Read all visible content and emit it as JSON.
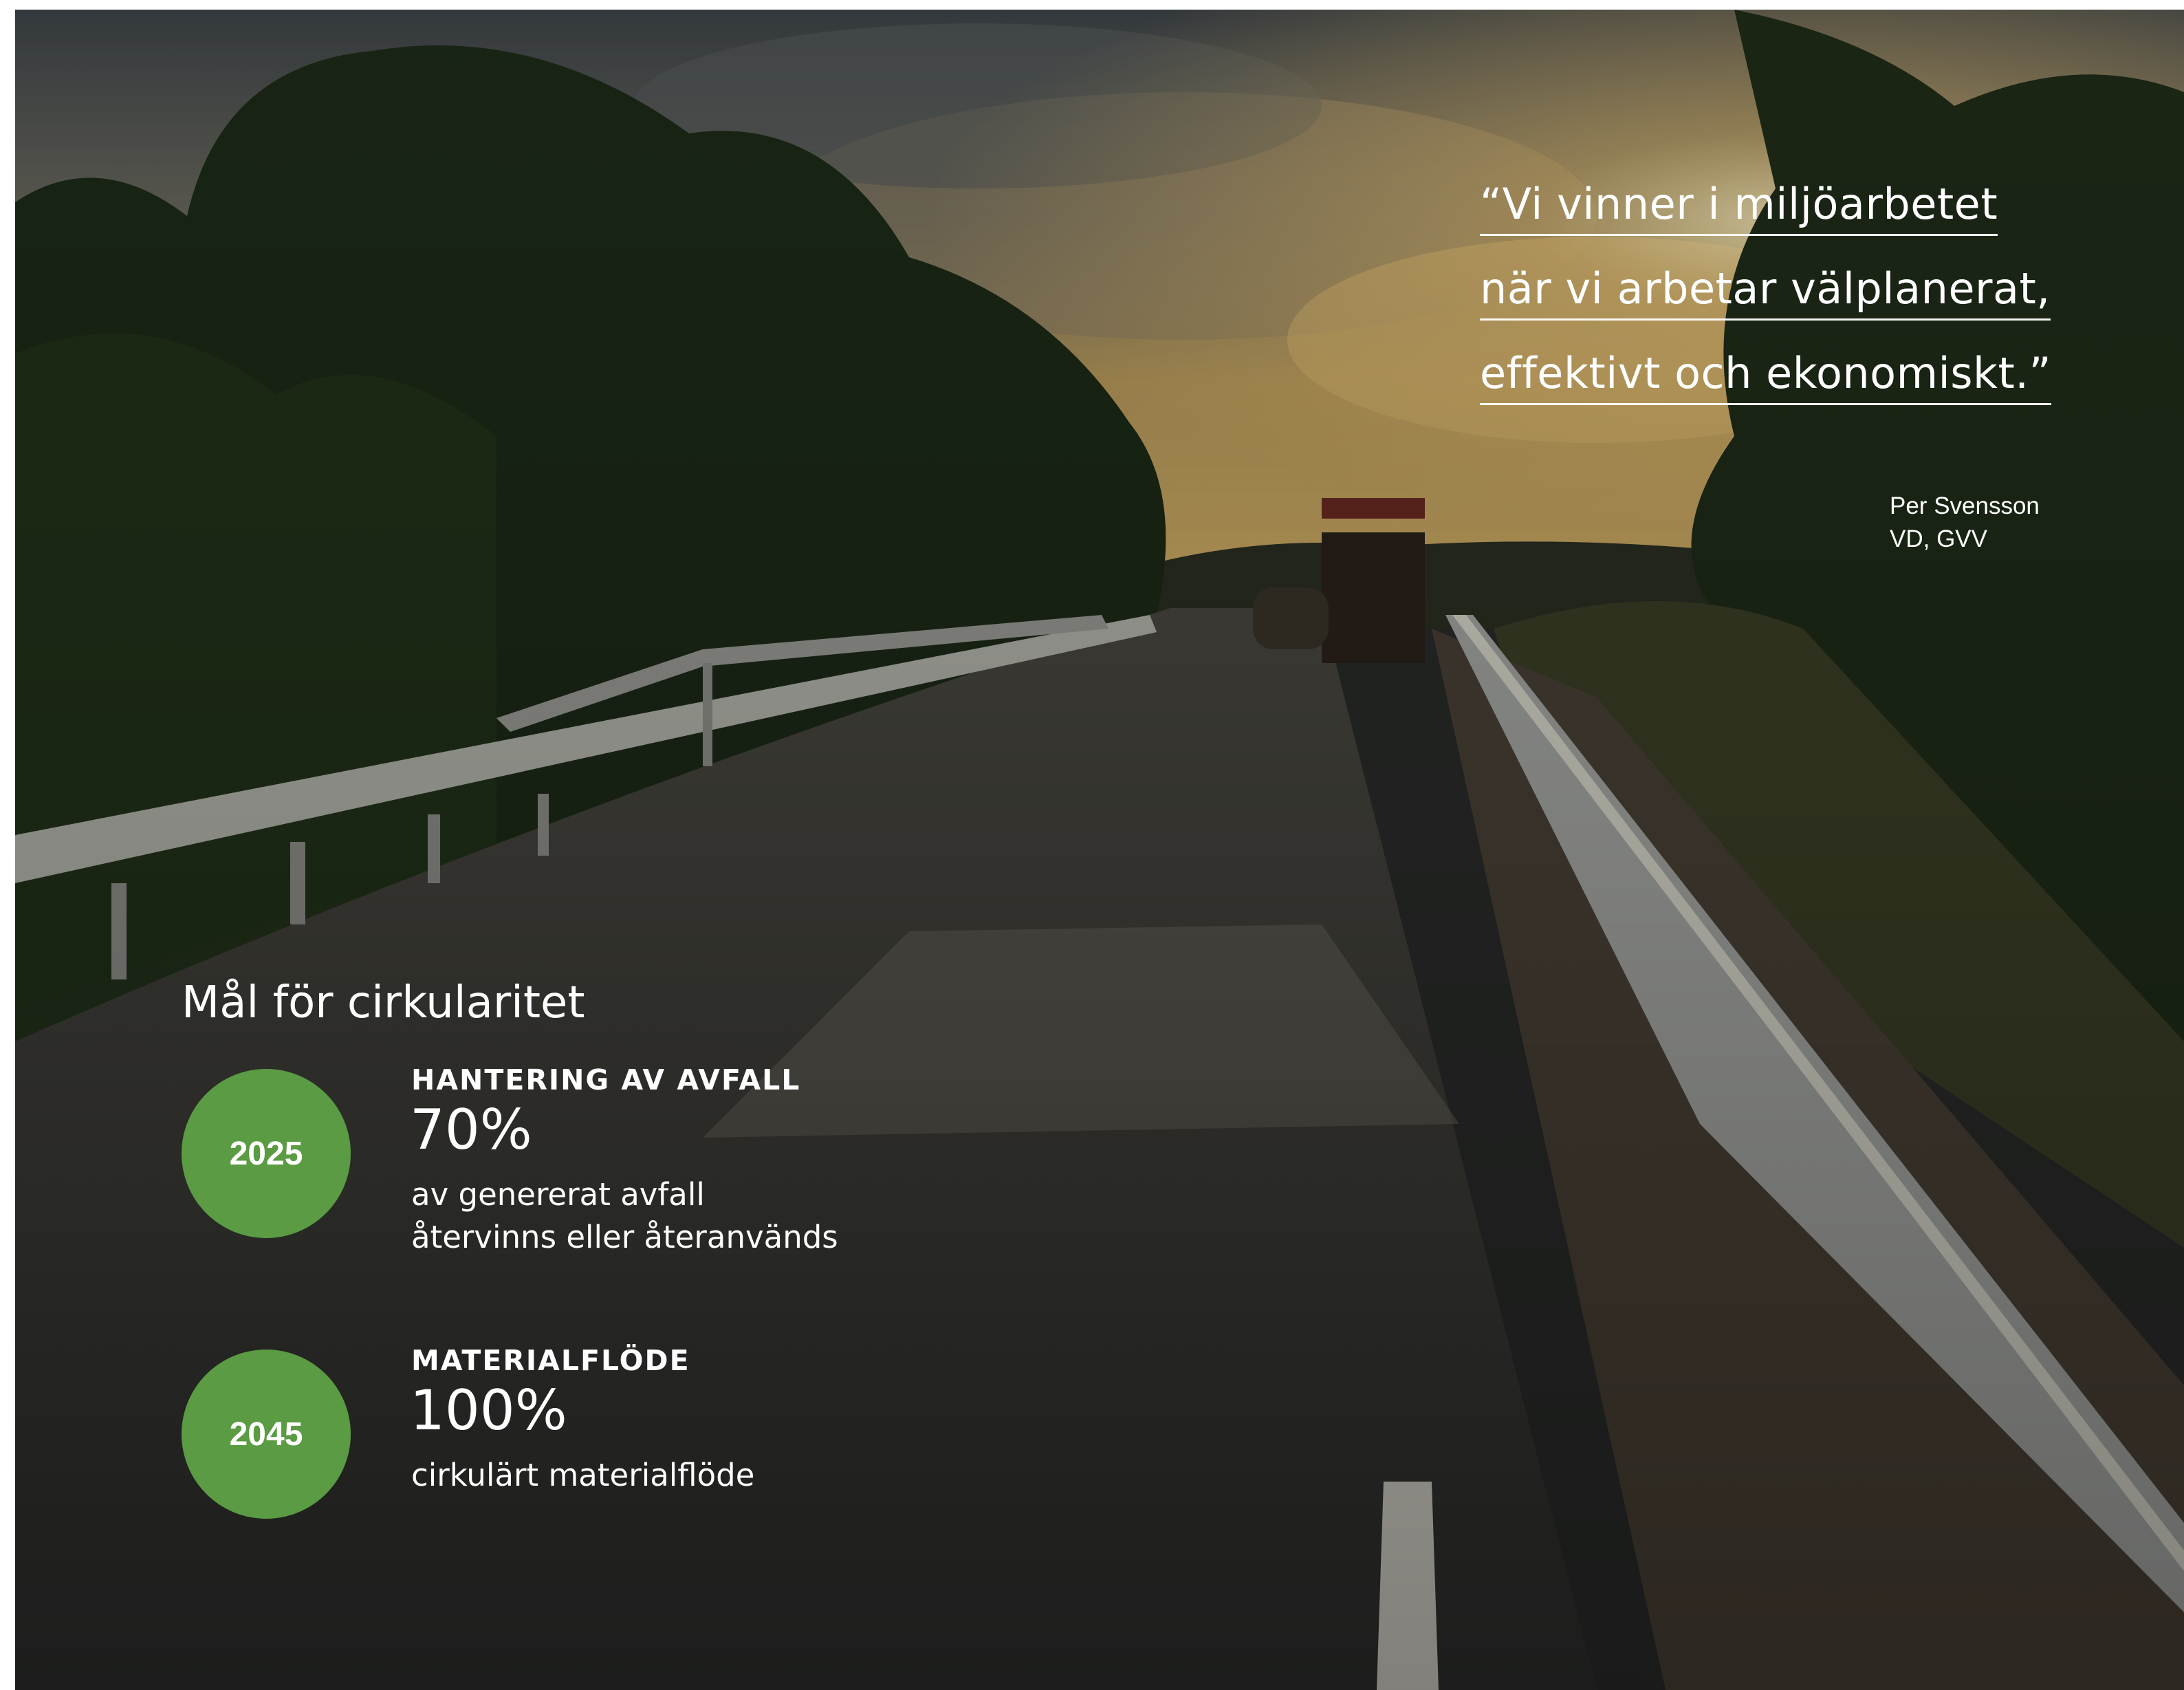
{
  "quote": {
    "lines": [
      "“Vi vinner i miljöarbetet",
      "när vi arbetar välplanerat,",
      "effektivt och ekonomiskt.”"
    ],
    "author_name": "Per Svensson",
    "author_title": "VD, GVV"
  },
  "goals": {
    "title": "Mål för cirkularitet",
    "items": [
      {
        "year": "2025",
        "heading": "HANTERING AV AVFALL",
        "value": "70%",
        "desc_lines": [
          "av genererat avfall",
          "återvinns eller återanvänds"
        ]
      },
      {
        "year": "2045",
        "heading": "MATERIALFLÖDE",
        "value": "100%",
        "desc_lines": [
          "cirkulärt materialflöde"
        ]
      }
    ]
  },
  "colors": {
    "accent_green": "#5a9b43",
    "text": "#ffffff"
  }
}
